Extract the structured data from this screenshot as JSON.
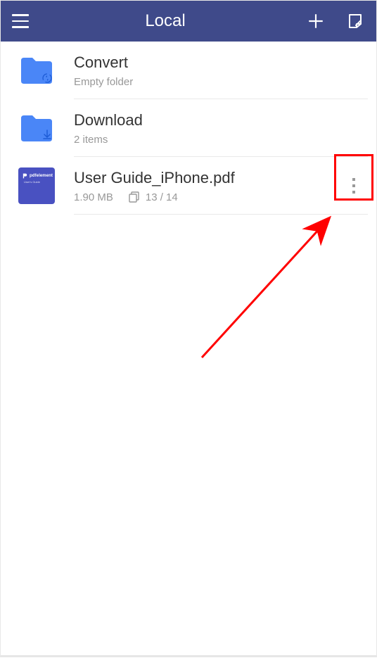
{
  "header": {
    "title": "Local"
  },
  "items": {
    "convert": {
      "title": "Convert",
      "subtitle": "Empty folder"
    },
    "download": {
      "title": "Download",
      "subtitle": "2 items"
    },
    "userguide": {
      "title": "User Guide_iPhone.pdf",
      "size": "1.90 MB",
      "pages": "13 / 14",
      "thumb_brand": "pdfelement",
      "thumb_sub": "User's Guide"
    }
  },
  "colors": {
    "accent": "#3f4a8a",
    "folder": "#4a86f7",
    "pdf_thumb": "#4951c1",
    "annotation": "#ff0000"
  }
}
